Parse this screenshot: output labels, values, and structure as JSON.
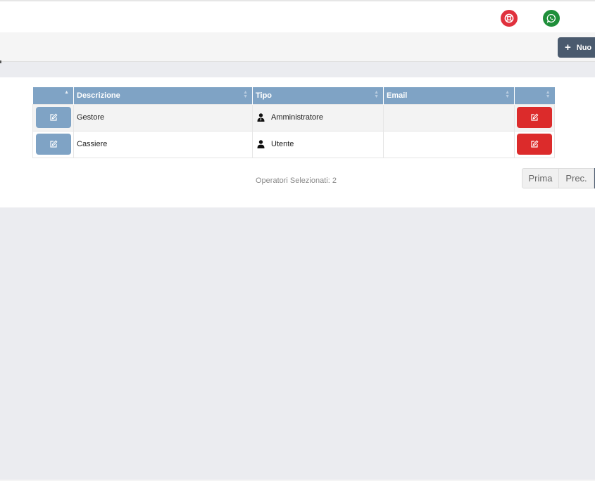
{
  "header": {
    "support_icon": "lifebuoy-icon",
    "whatsapp_icon": "whatsapp-icon",
    "colors": {
      "support": "#e0313d",
      "whatsapp": "#1f8f3a"
    }
  },
  "toolbar": {
    "new_label": "Nuo"
  },
  "table": {
    "columns": [
      "",
      "Descrizione",
      "Tipo",
      "Email",
      ""
    ],
    "rows": [
      {
        "descrizione": "Gestore",
        "tipo": "Amministratore",
        "tipo_icon": "user-tie-icon",
        "email": ""
      },
      {
        "descrizione": "Cassiere",
        "tipo": "Utente",
        "tipo_icon": "user-icon",
        "email": ""
      }
    ],
    "colors": {
      "header": "#7fa3c5",
      "delete": "#dc2b2b"
    }
  },
  "footer": {
    "info": "Operatori Selezionati: 2"
  },
  "pager": {
    "first": "Prima",
    "prev": "Prec."
  }
}
